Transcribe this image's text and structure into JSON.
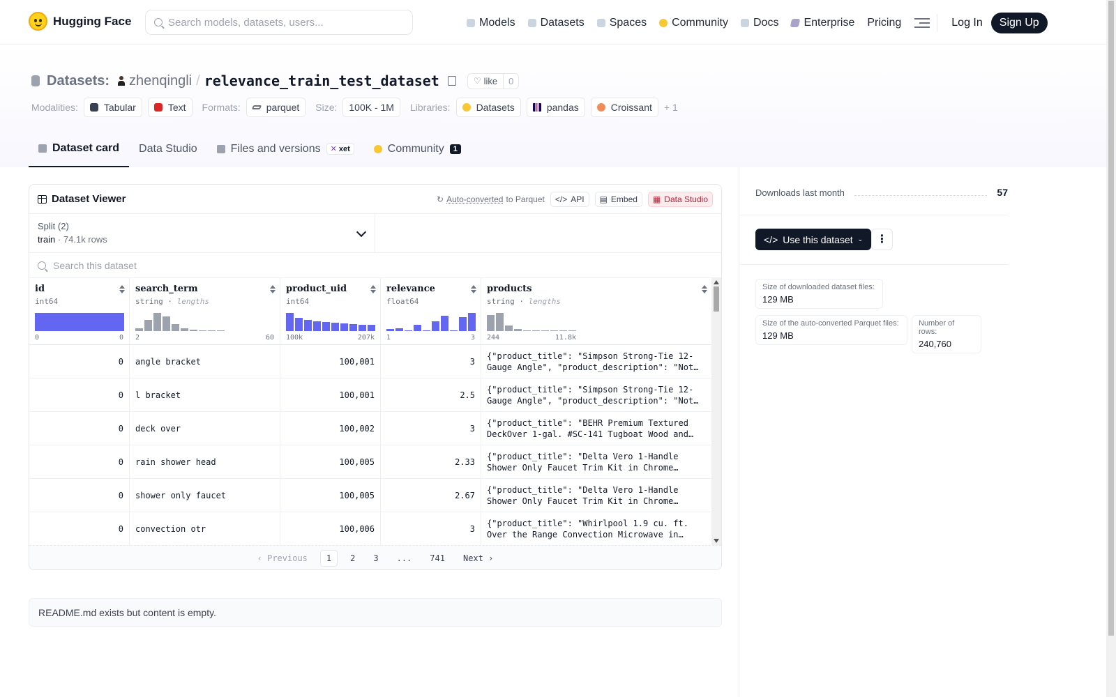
{
  "nav": {
    "brand": "Hugging Face",
    "search_placeholder": "Search models, datasets, users...",
    "links": [
      "Models",
      "Datasets",
      "Spaces",
      "Community",
      "Docs",
      "Enterprise",
      "Pricing"
    ],
    "login": "Log In",
    "signup": "Sign Up"
  },
  "repo": {
    "kind": "Datasets:",
    "user": "zhenqingli",
    "name": "relevance_train_test_dataset",
    "like_label": "like",
    "like_count": "0"
  },
  "tags": {
    "modalities_label": "Modalities:",
    "modalities": [
      "Tabular",
      "Text"
    ],
    "formats_label": "Formats:",
    "formats": [
      "parquet"
    ],
    "size_label": "Size:",
    "size": "100K - 1M",
    "libraries_label": "Libraries:",
    "libraries": [
      "Datasets",
      "pandas",
      "Croissant"
    ],
    "more": "+ 1"
  },
  "tabs": {
    "card": "Dataset card",
    "studio": "Data Studio",
    "files": "Files and versions",
    "xet": "xet",
    "community": "Community",
    "community_count": "1"
  },
  "viewer": {
    "title": "Dataset Viewer",
    "auto_converted": "Auto-converted",
    "to_parquet": "to Parquet",
    "api": "API",
    "embed": "Embed",
    "data_studio": "Data Studio",
    "split_label": "Split (2)",
    "split_name": "train",
    "split_rows": "74.1k rows",
    "search_placeholder": "Search this dataset",
    "columns": [
      {
        "name": "id",
        "type": "int64",
        "range_min": "0",
        "range_max": "0"
      },
      {
        "name": "search_term",
        "type": "string",
        "type_extra": "lengths",
        "range_min": "2",
        "range_max": "60"
      },
      {
        "name": "product_uid",
        "type": "int64",
        "range_min": "100k",
        "range_max": "207k"
      },
      {
        "name": "relevance",
        "type": "float64",
        "range_min": "1",
        "range_max": "3"
      },
      {
        "name": "products",
        "type": "string",
        "type_extra": "lengths",
        "range_min": "244",
        "range_max": "11.8k"
      }
    ],
    "histograms": {
      "id": [
        1.0
      ],
      "search_term": [
        0.15,
        0.6,
        1.0,
        0.8,
        0.4,
        0.15,
        0.06,
        0.04,
        0.03,
        0.02
      ],
      "product_uid": [
        1.0,
        0.72,
        0.6,
        0.52,
        0.5,
        0.45,
        0.42,
        0.38,
        0.36,
        0.33
      ],
      "relevance": [
        0.12,
        0.15,
        0.05,
        0.35,
        0.02,
        0.55,
        0.85,
        0.05,
        0.78,
        1.0
      ],
      "products": [
        0.9,
        1.0,
        0.3,
        0.1,
        0.05,
        0.03,
        0.02,
        0.02,
        0.01,
        0.01
      ]
    },
    "rows": [
      {
        "id": "0",
        "search_term": "angle bracket",
        "product_uid": "100,001",
        "relevance": "3",
        "products": "{\"product_title\": \"Simpson Strong-Tie 12-Gauge Angle\", \"product_description\": \"Not…"
      },
      {
        "id": "0",
        "search_term": "l bracket",
        "product_uid": "100,001",
        "relevance": "2.5",
        "products": "{\"product_title\": \"Simpson Strong-Tie 12-Gauge Angle\", \"product_description\": \"Not…"
      },
      {
        "id": "0",
        "search_term": "deck over",
        "product_uid": "100,002",
        "relevance": "3",
        "products": "{\"product_title\": \"BEHR Premium Textured DeckOver 1-gal. #SC-141 Tugboat Wood and…"
      },
      {
        "id": "0",
        "search_term": "rain shower head",
        "product_uid": "100,005",
        "relevance": "2.33",
        "products": "{\"product_title\": \"Delta Vero 1-Handle Shower Only Faucet Trim Kit in Chrome…"
      },
      {
        "id": "0",
        "search_term": "shower only faucet",
        "product_uid": "100,005",
        "relevance": "2.67",
        "products": "{\"product_title\": \"Delta Vero 1-Handle Shower Only Faucet Trim Kit in Chrome…"
      },
      {
        "id": "0",
        "search_term": "convection otr",
        "product_uid": "100,006",
        "relevance": "3",
        "products": "{\"product_title\": \"Whirlpool 1.9 cu. ft. Over the Range Convection Microwave in…"
      }
    ],
    "pager": {
      "prev": "Previous",
      "pages": [
        "1",
        "2",
        "3",
        "...",
        "741"
      ],
      "next": "Next"
    }
  },
  "readme": "README.md exists but content is empty.",
  "side": {
    "downloads_label": "Downloads last month",
    "downloads_value": "57",
    "use_button": "Use this dataset",
    "size_dl_label": "Size of downloaded dataset files:",
    "size_dl_value": "129 MB",
    "size_pq_label": "Size of the auto-converted Parquet files:",
    "size_pq_value": "129 MB",
    "rows_label": "Number of rows:",
    "rows_value": "240,760"
  },
  "colors": {
    "accent_bar": "#6366f1",
    "hist_gray": "#9ca3af",
    "dark": "#111827"
  }
}
